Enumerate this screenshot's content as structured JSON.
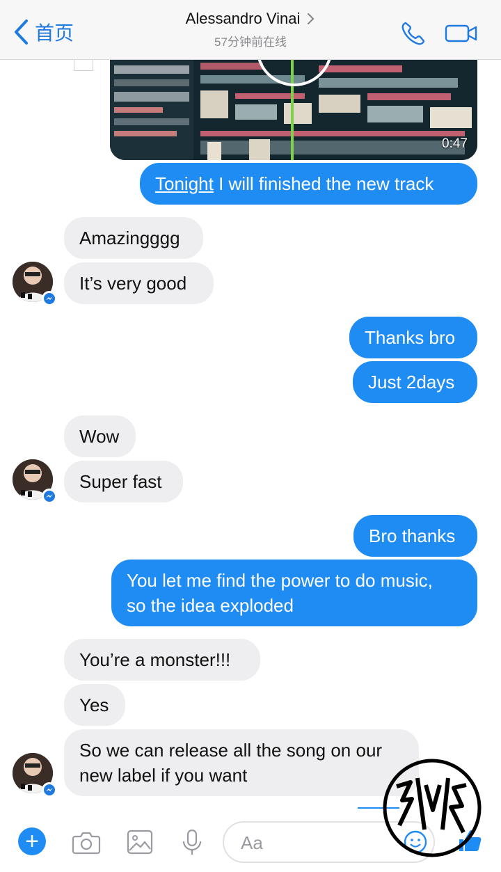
{
  "header": {
    "back_label": "首页",
    "contact_name": "Alessandro Vinai",
    "status": "57分钟前在线"
  },
  "video": {
    "duration": "0:47"
  },
  "messages": [
    {
      "side": "out",
      "text_prefix": "Tonight",
      "text_rest": " I will finished the new track"
    },
    {
      "side": "in",
      "text": "Amazingggg"
    },
    {
      "side": "in",
      "text": "It’s very good"
    },
    {
      "side": "out",
      "text": "Thanks bro"
    },
    {
      "side": "out",
      "text": "Just 2days"
    },
    {
      "side": "in",
      "text": "Wow"
    },
    {
      "side": "in",
      "text": "Super fast"
    },
    {
      "side": "out",
      "text": "Bro thanks"
    },
    {
      "side": "out",
      "text_line1": "You let me find the power to do music,",
      "text_line2": "so the idea exploded"
    },
    {
      "side": "in",
      "text": "You’re a monster!!!"
    },
    {
      "side": "in",
      "text": "Yes"
    },
    {
      "side": "in",
      "text_line1": "So we can release all the song on our",
      "text_line2": "new label if you want"
    }
  ],
  "composer": {
    "placeholder": "Aa"
  },
  "colors": {
    "accent": "#1f8cf3",
    "incoming_bubble": "#eeeef0",
    "header_bg": "#f7f7f8"
  },
  "icons": [
    "back-chevron-icon",
    "phone-icon",
    "video-camera-icon",
    "plus-icon",
    "camera-icon",
    "image-icon",
    "microphone-icon",
    "emoji-icon",
    "thumbs-up-icon",
    "messenger-badge-icon"
  ]
}
